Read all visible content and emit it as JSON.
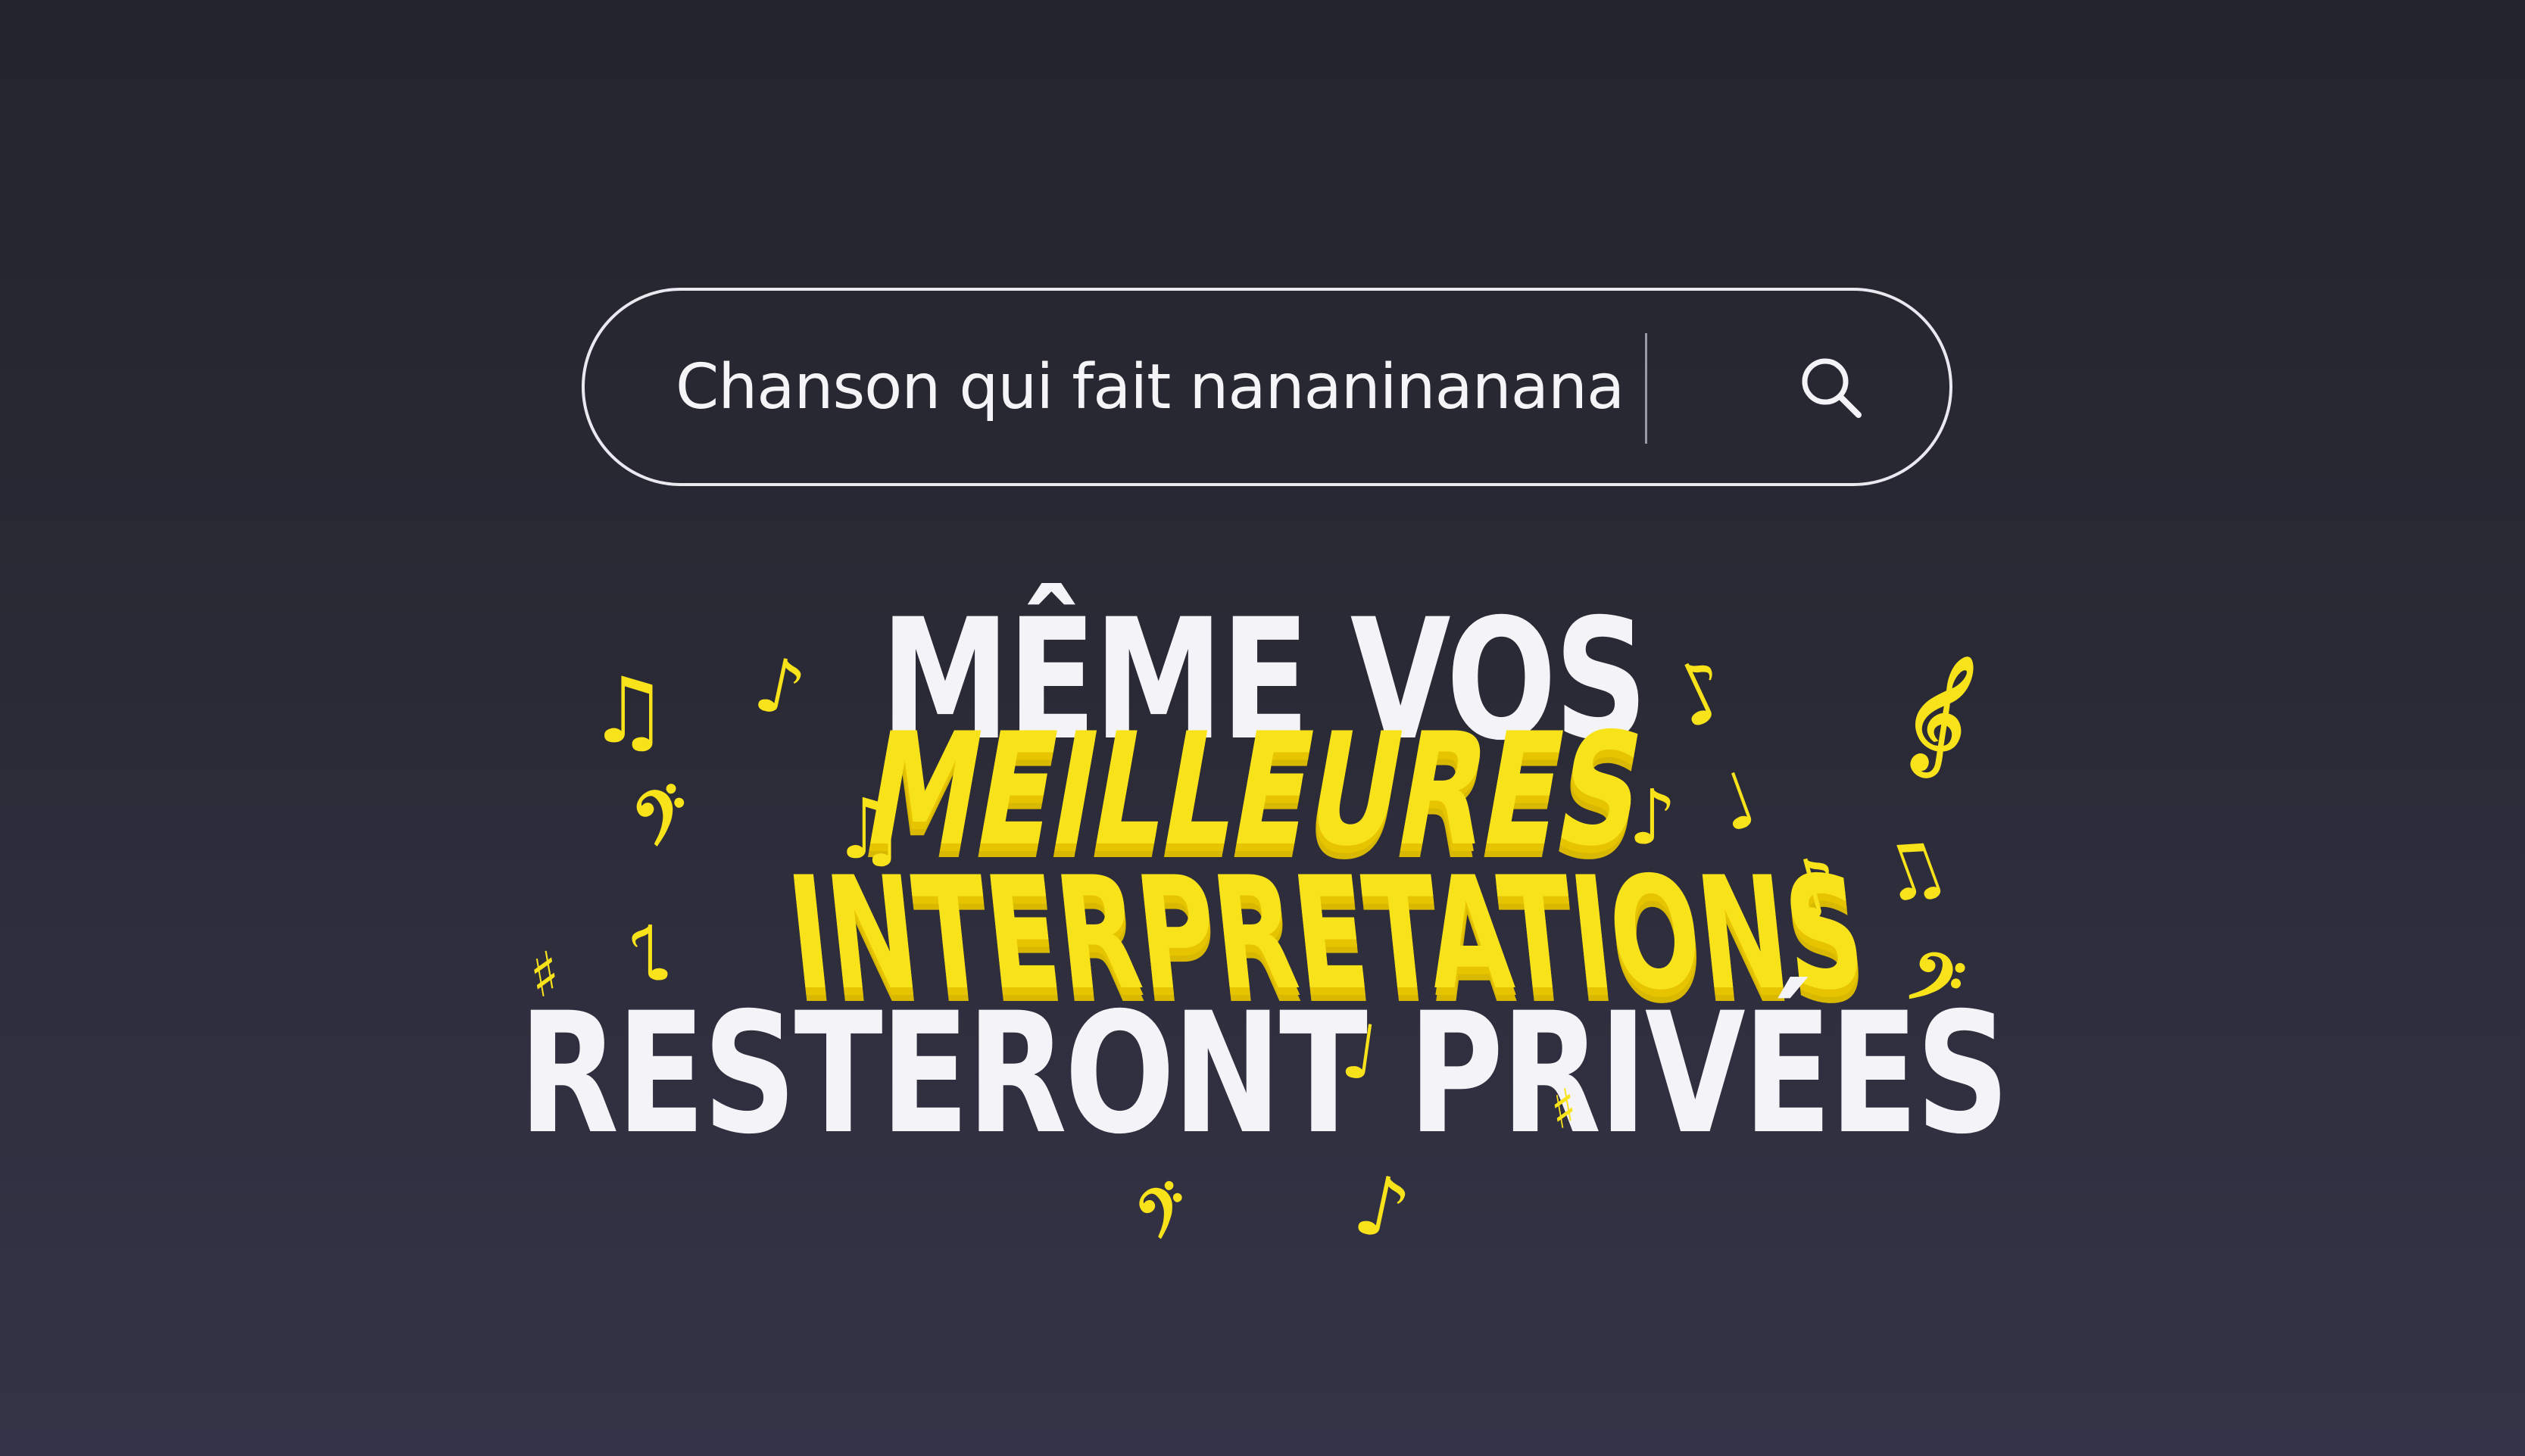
{
  "search": {
    "query": "Chanson qui fait nananinanana",
    "icon": "search-icon"
  },
  "headline": {
    "line1": "MÊME VOS",
    "line2": "MEILLEURES",
    "line3": "INTERPRETATIONS",
    "line4": "RESTERONT PRIVÉES"
  },
  "notes": {
    "n1": "♫",
    "n2": "♪",
    "n3": "♫",
    "n4": "♪",
    "n5": "𝄞",
    "n6": "♪",
    "n7": "♩",
    "n8": "𝄢",
    "n9": "♪",
    "n10": "♯",
    "n11": "♪",
    "n12": "♫",
    "n13": "♯",
    "n14": "𝄢",
    "n15": "♩",
    "n16": "♪",
    "n17": "𝄢"
  },
  "colors": {
    "background": "#2a2a36",
    "accent_yellow": "#f8e21a",
    "text_white": "#f4f4f8"
  }
}
